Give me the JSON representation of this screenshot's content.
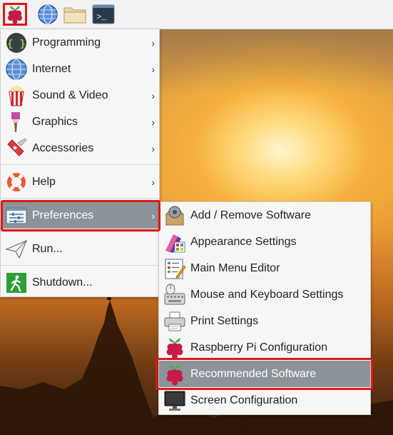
{
  "panel": {
    "menu_button_icon": "raspberry-icon",
    "launchers": [
      {
        "name": "web-browser-icon"
      },
      {
        "name": "file-manager-icon"
      },
      {
        "name": "terminal-icon"
      }
    ],
    "terminal_glyph": ">_"
  },
  "main_menu": {
    "items": [
      {
        "label": "Programming",
        "icon": "programming-icon"
      },
      {
        "label": "Internet",
        "icon": "internet-icon"
      },
      {
        "label": "Sound & Video",
        "icon": "sound-video-icon"
      },
      {
        "label": "Graphics",
        "icon": "graphics-icon"
      },
      {
        "label": "Accessories",
        "icon": "accessories-icon"
      },
      {
        "label": "Help",
        "icon": "help-icon"
      },
      {
        "label": "Preferences",
        "icon": "preferences-icon"
      },
      {
        "label": "Run...",
        "icon": "run-icon"
      },
      {
        "label": "Shutdown...",
        "icon": "shutdown-icon"
      }
    ],
    "programming_glyph": "{ }"
  },
  "preferences_menu": {
    "items": [
      {
        "label": "Add / Remove Software",
        "icon": "add-remove-software-icon"
      },
      {
        "label": "Appearance Settings",
        "icon": "appearance-settings-icon"
      },
      {
        "label": "Main Menu Editor",
        "icon": "main-menu-editor-icon"
      },
      {
        "label": "Mouse and Keyboard Settings",
        "icon": "mouse-keyboard-icon"
      },
      {
        "label": "Print Settings",
        "icon": "printer-icon"
      },
      {
        "label": "Raspberry Pi Configuration",
        "icon": "raspberry-icon"
      },
      {
        "label": "Recommended Software",
        "icon": "raspberry-icon"
      },
      {
        "label": "Screen Configuration",
        "icon": "monitor-icon"
      }
    ]
  },
  "arrow_glyph": "›",
  "colors": {
    "highlight": "#8c9399",
    "annotation": "#e01818",
    "raspberry": "#c51a4a",
    "leaf": "#4caf50"
  }
}
